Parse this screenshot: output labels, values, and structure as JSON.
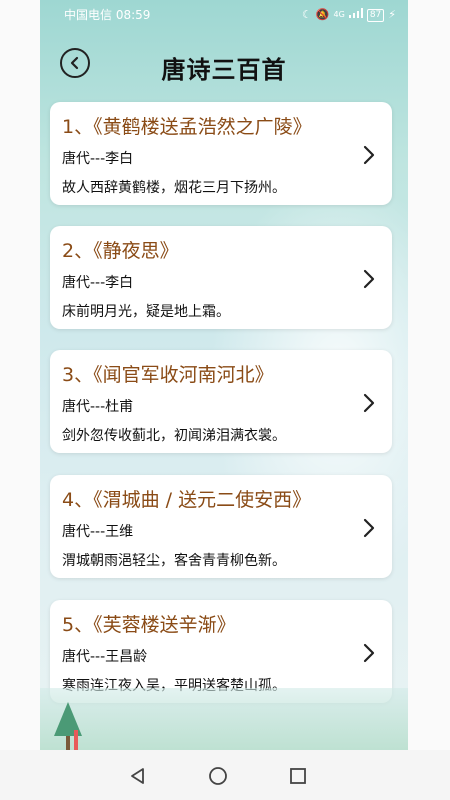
{
  "status_bar": {
    "carrier_time": "中国电信 08:59",
    "network": "4G",
    "battery": "87"
  },
  "header": {
    "title": "唐诗三百首"
  },
  "poems": [
    {
      "title": "1、《黄鹤楼送孟浩然之广陵》",
      "author": "唐代---李白",
      "line": "故人西辞黄鹤楼，烟花三月下扬州。"
    },
    {
      "title": "2、《静夜思》",
      "author": "唐代---李白",
      "line": "床前明月光，疑是地上霜。"
    },
    {
      "title": "3、《闻官军收河南河北》",
      "author": "唐代---杜甫",
      "line": "剑外忽传收蓟北，初闻涕泪满衣裳。"
    },
    {
      "title": "4、《渭城曲 / 送元二使安西》",
      "author": "唐代---王维",
      "line": "渭城朝雨浥轻尘，客舍青青柳色新。"
    },
    {
      "title": "5、《芙蓉楼送辛渐》",
      "author": "唐代---王昌龄",
      "line": "寒雨连江夜入吴，平明送客楚山孤。"
    }
  ],
  "icons": {
    "back": "back-arrow-icon",
    "chevron": "chevron-right-icon",
    "nav_back": "triangle-back-icon",
    "nav_home": "circle-home-icon",
    "nav_recent": "square-recent-icon"
  },
  "colors": {
    "title_color": "#8a4b16",
    "bg_top": "#9ed7d2"
  }
}
